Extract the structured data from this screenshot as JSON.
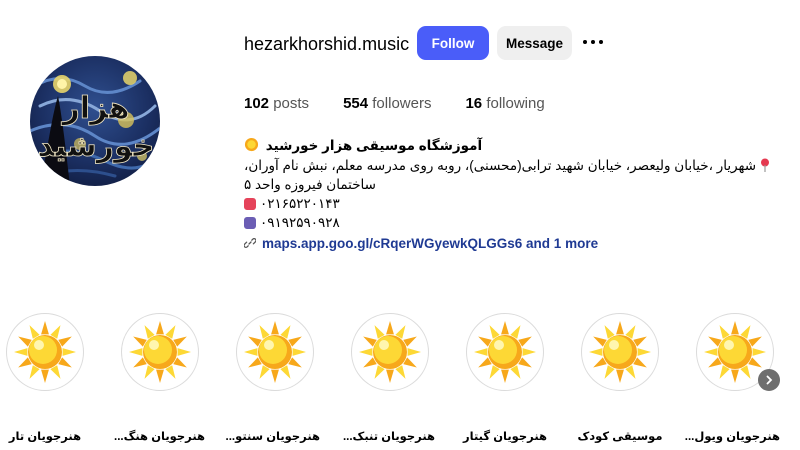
{
  "profile": {
    "username": "hezarkhorshid.music",
    "follow_label": "Follow",
    "message_label": "Message",
    "avatar_text_line1": "هزار",
    "avatar_text_line2": "خورشید"
  },
  "stats": {
    "posts_count": "102",
    "posts_label": "posts",
    "followers_count": "554",
    "followers_label": "followers",
    "following_count": "16",
    "following_label": "following"
  },
  "bio": {
    "name": "آموزشگاه موسیقی هزار خورشید",
    "address": "شهریار ،خیابان ولیعصر، خیابان شهید ترابی(محسنی)، روبه روی مدرسه معلم، نبش نام آوران، ساختمان فیروزه واحد ۵",
    "phone1": "۰۲۱۶۵۲۲۰۱۴۳",
    "phone2": "۰۹۱۹۲۵۹۰۹۲۸",
    "link": "maps.app.goo.gl/cRqerWGyewkQLGGs6 and 1 more"
  },
  "colors": {
    "follow_button": "#4a5df9",
    "message_button": "#efefef",
    "link": "#1f3a93",
    "sun_yellow": "#fdd835",
    "sun_orange": "#f7a81b"
  },
  "highlights": [
    {
      "label": "هنرجویان تار"
    },
    {
      "label": "هنرجویان هنگ..."
    },
    {
      "label": "هنرجویان سنتو..."
    },
    {
      "label": "هنرجویان تنبک..."
    },
    {
      "label": "هنرجویان گیتار"
    },
    {
      "label": "موسیقی کودک"
    },
    {
      "label": "هنرجویان ویول..."
    }
  ],
  "icons": {
    "more": "more-dots-icon",
    "pin": "location-pin-icon",
    "phone": "telephone-icon",
    "mobile": "mobile-phone-icon",
    "link": "link-icon",
    "next": "chevron-right-icon"
  }
}
